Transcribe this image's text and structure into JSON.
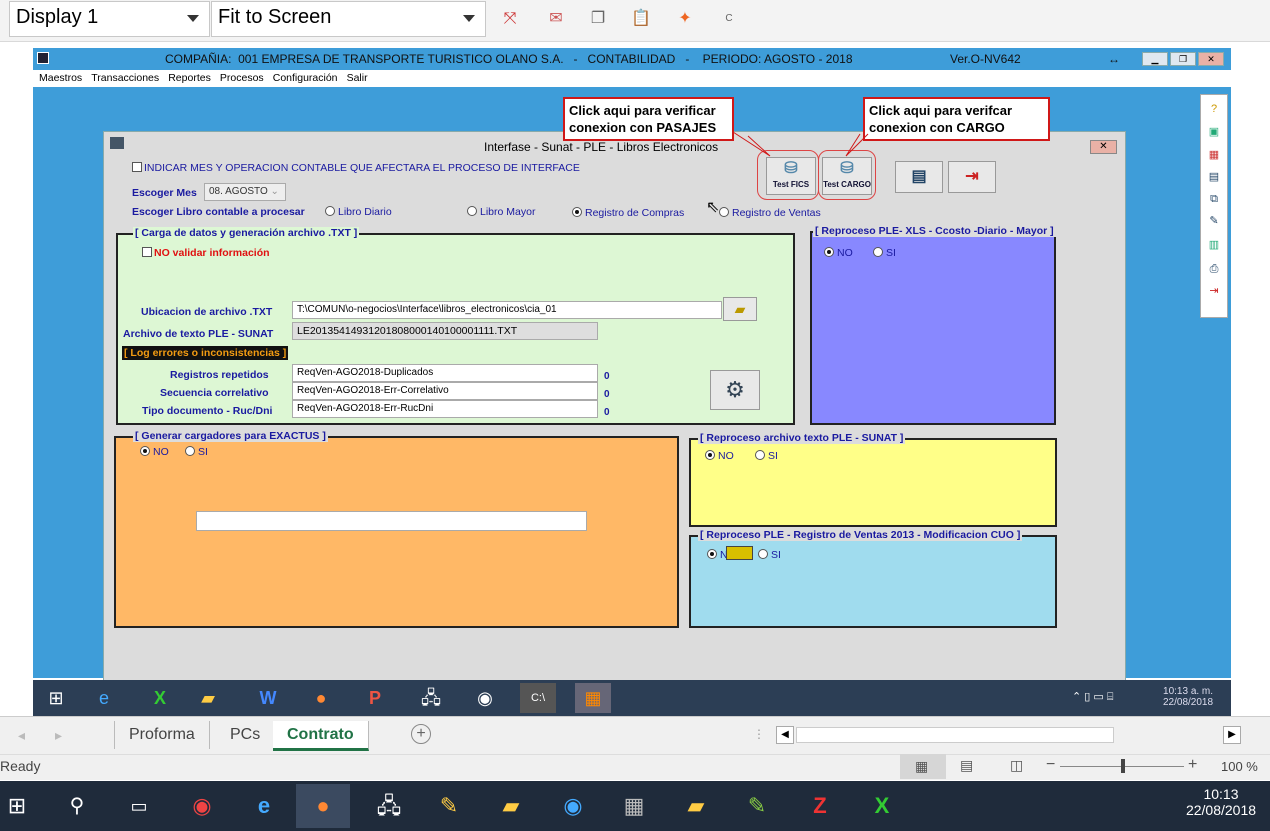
{
  "viewer": {
    "display_select": "Display 1",
    "zoom_select": "Fit to Screen"
  },
  "app": {
    "title": "COMPAÑIA:  001 EMPRESA DE TRANSPORTE TURISTICO OLANO S.A.   -   CONTABILIDAD   -    PERIODO: AGOSTO - 2018",
    "version": "Ver.O-NV642",
    "resize_glyph": "↔",
    "menu": [
      "Maestros",
      "Transacciones",
      "Reportes",
      "Procesos",
      "Configuración",
      "Salir"
    ]
  },
  "dialog": {
    "title": "Interfase - Sunat - PLE - Libros Electronicos",
    "indicar_checkbox": "INDICAR MES Y OPERACION CONTABLE QUE AFECTARA EL PROCESO DE INTERFACE",
    "escoger_mes_label": "Escoger Mes",
    "mes_value": "08. AGOSTO",
    "escoger_libro_label": "Escoger Libro contable a procesar",
    "libros": [
      {
        "label": "Libro Diario",
        "selected": false
      },
      {
        "label": "Libro Mayor",
        "selected": false
      },
      {
        "label": "Registro de Compras",
        "selected": true
      },
      {
        "label": "Registro de Ventas",
        "selected": false
      }
    ],
    "buttons": {
      "test_fics": "Test FICS",
      "test_cargo": "Test CARGO"
    },
    "carga": {
      "title": "[ Carga de datos y generación archivo  .TXT ]",
      "no_validar": "NO validar información",
      "ubicacion_label": "Ubicacion de archivo .TXT",
      "ubicacion_value": "T:\\COMUN\\o-negocios\\Interface\\libros_electronicos\\cia_01",
      "archivo_label": "Archivo de texto PLE - SUNAT",
      "archivo_value": "LE20135414931201808000140100001111.TXT",
      "log_label": "[ Log errores o inconsistencias ]",
      "rows": [
        {
          "label": "Registros repetidos",
          "value": "ReqVen-AGO2018-Duplicados",
          "count": "0"
        },
        {
          "label": "Secuencia correlativo",
          "value": "ReqVen-AGO2018-Err-Correlativo",
          "count": "0"
        },
        {
          "label": "Tipo documento - Ruc/Dni",
          "value": "ReqVen-AGO2018-Err-RucDni",
          "count": "0"
        }
      ]
    },
    "reproceso_xls": {
      "title": "[ Reproceso PLE- XLS - Ccosto -Diario - Mayor ]",
      "no": "NO",
      "si": "SI"
    },
    "exactus": {
      "title": "[ Generar cargadores para EXACTUS  ]",
      "no": "NO",
      "si": "SI"
    },
    "reproceso_txt": {
      "title": "[ Reproceso archivo texto PLE - SUNAT ]",
      "no": "NO",
      "si": "SI"
    },
    "reproceso_ventas": {
      "title": "[  Reproceso PLE - Registro de Ventas 2013 - Modificacion CUO  ]",
      "no": "NO",
      "si": "SI"
    }
  },
  "callouts": {
    "pasajes": "Click aqui para verificar conexion con PASAJES",
    "cargo": "Click aqui para verifcar conexion con CARGO"
  },
  "remote_tray": {
    "time": "10:13 a. m.",
    "date": "22/08/2018"
  },
  "excel": {
    "sheets": [
      "Proforma",
      "PCs",
      "Contrato"
    ],
    "active_sheet": "Contrato",
    "status": "Ready",
    "zoom": "100 %"
  },
  "taskbar": {
    "time": "10:13",
    "date": "22/08/2018"
  },
  "colors": {
    "app_bg": "#3e9dd9",
    "carga_panel": "#ddf7d4",
    "xls_panel": "#8888ff",
    "exactus_panel": "#ffb866",
    "txt_panel": "#ffff88",
    "ventas_panel": "#a0dcee",
    "callout_border": "#d01818"
  }
}
